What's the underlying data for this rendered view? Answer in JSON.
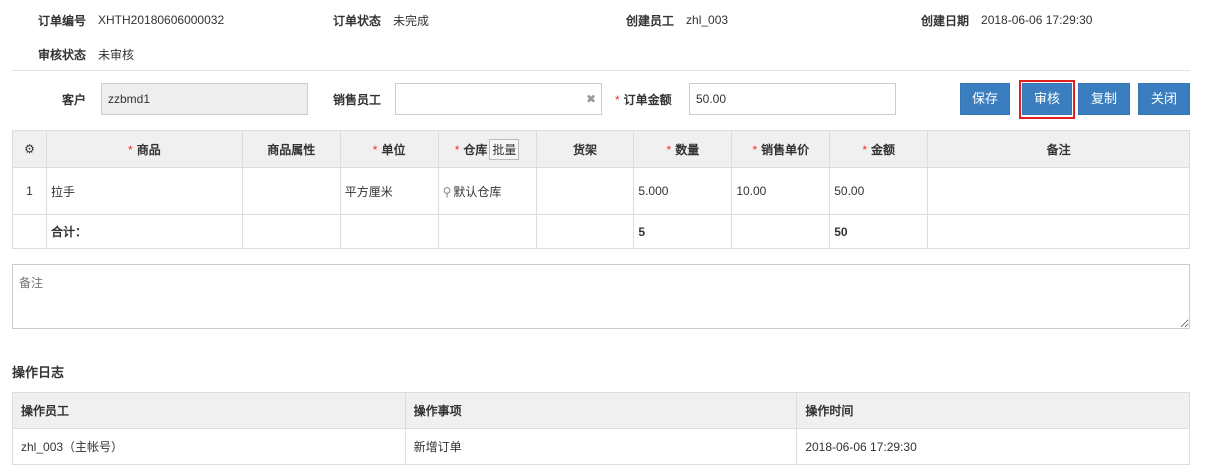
{
  "header": {
    "order_no_label": "订单编号",
    "order_no": "XHTH20180606000032",
    "order_status_label": "订单状态",
    "order_status": "未完成",
    "creator_label": "创建员工",
    "creator": "zhl_003",
    "created_date_label": "创建日期",
    "created_date": "2018-06-06 17:29:30",
    "audit_status_label": "审核状态",
    "audit_status": "未审核"
  },
  "form": {
    "customer_label": "客户",
    "customer_value": "zzbmd1",
    "sales_staff_label": "销售员工",
    "sales_staff_value": "",
    "clear_symbol": "✖",
    "amount_label": "订单金额",
    "amount_value": "50.00",
    "required_mark": "*"
  },
  "buttons": {
    "save": "保存",
    "audit": "审核",
    "copy": "复制",
    "close": "关闭"
  },
  "grid": {
    "columns": {
      "gear": "⚙",
      "product": "商品",
      "attr": "商品属性",
      "unit": "单位",
      "warehouse": "仓库",
      "batch": "批量",
      "shelf": "货架",
      "qty": "数量",
      "price": "销售单价",
      "amount": "金额",
      "note": "备注"
    },
    "rows": [
      {
        "index": "1",
        "product": "拉手",
        "attr": "",
        "unit": "平方厘米",
        "warehouse": "默认仓库",
        "shelf": "",
        "qty": "5.000",
        "price": "10.00",
        "amount": "50.00",
        "note": ""
      }
    ],
    "sum": {
      "label": "合计：",
      "qty": "5",
      "amount": "50"
    }
  },
  "remark_placeholder": "备注",
  "log": {
    "title": "操作日志",
    "headers": {
      "staff": "操作员工",
      "action": "操作事项",
      "time": "操作时间"
    },
    "rows": [
      {
        "staff": "zhl_003（主帐号）",
        "action": "新增订单",
        "time": "2018-06-06 17:29:30"
      }
    ]
  }
}
